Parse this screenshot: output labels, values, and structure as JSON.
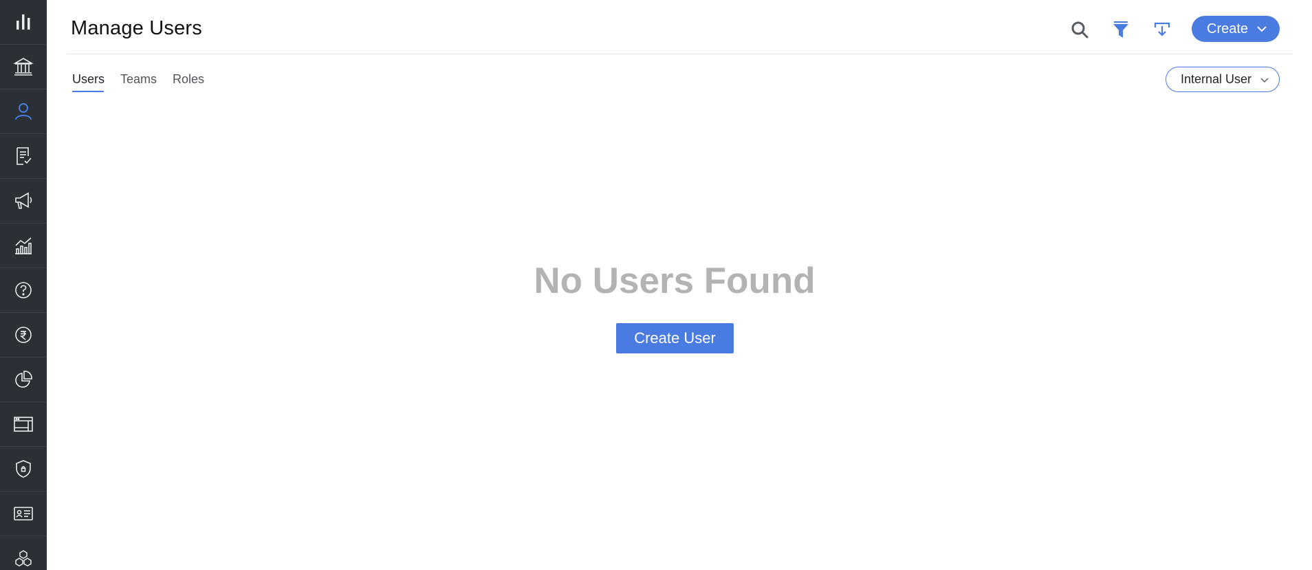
{
  "sidebar": {
    "items": [
      {
        "name": "bar-chart-icon",
        "active": false
      },
      {
        "name": "bank-icon",
        "active": false
      },
      {
        "name": "user-icon",
        "active": true
      },
      {
        "name": "document-check-icon",
        "active": false
      },
      {
        "name": "megaphone-icon",
        "active": false
      },
      {
        "name": "line-chart-icon",
        "active": false
      },
      {
        "name": "help-icon",
        "active": false
      },
      {
        "name": "rupee-icon",
        "active": false
      },
      {
        "name": "pie-chart-icon",
        "active": false
      },
      {
        "name": "browser-window-icon",
        "active": false
      },
      {
        "name": "shield-icon",
        "active": false
      },
      {
        "name": "id-card-icon",
        "active": false
      },
      {
        "name": "cubes-icon",
        "active": false
      }
    ]
  },
  "header": {
    "title": "Manage Users",
    "create_label": "Create"
  },
  "tabs": [
    {
      "label": "Users",
      "active": true
    },
    {
      "label": "Teams",
      "active": false
    },
    {
      "label": "Roles",
      "active": false
    }
  ],
  "user_type_select": {
    "selected": "Internal User"
  },
  "empty_state": {
    "title": "No Users Found",
    "button_label": "Create User"
  },
  "colors": {
    "accent": "#4a7be0",
    "sidebar_bg": "#2b3036",
    "icon": "#e9ecef",
    "empty_text": "#b3b3b3"
  }
}
